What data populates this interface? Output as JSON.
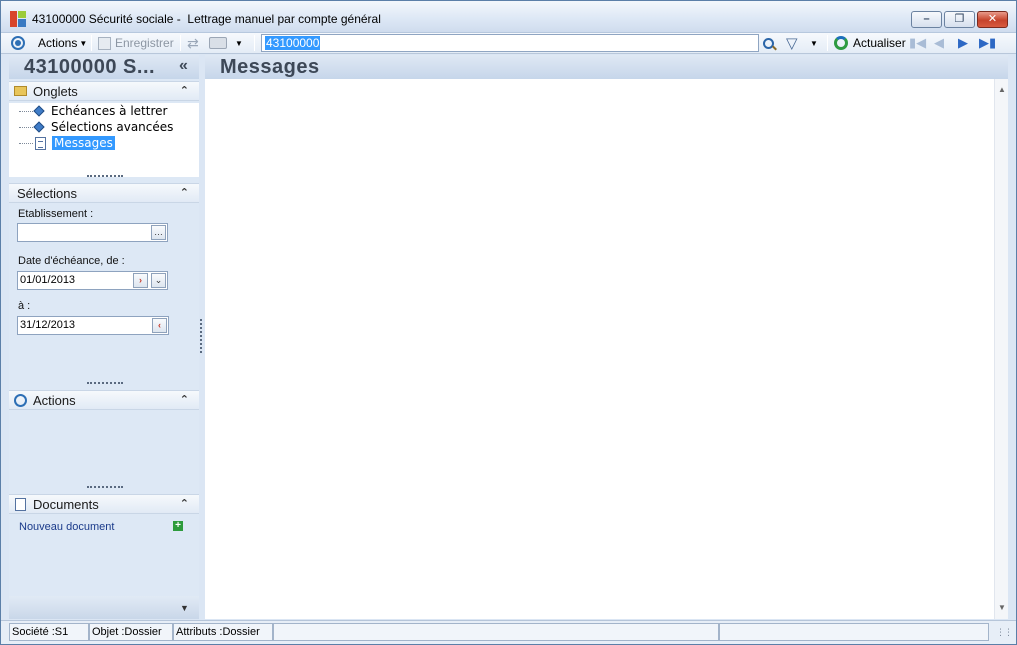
{
  "window": {
    "title": "43100000 Sécurité sociale -  Lettrage manuel par compte général"
  },
  "toolbar": {
    "actions_label": "Actions",
    "save_label": "Enregistrer",
    "search_value": "43100000",
    "refresh_label": "Actualiser"
  },
  "left_panel": {
    "title": "43100000 S...",
    "collapse_glyph": "«",
    "sections": {
      "onglets": {
        "label": "Onglets",
        "items": [
          {
            "label": "Echéances à lettrer",
            "icon": "diamond-icon"
          },
          {
            "label": "Sélections avancées",
            "icon": "diamond-icon"
          },
          {
            "label": "Messages",
            "icon": "document-icon",
            "selected": true
          }
        ]
      },
      "selections": {
        "label": "Sélections",
        "etablissement_label": "Etablissement :",
        "etablissement_value": "",
        "date_from_label": "Date d'échéance, de :",
        "date_from_value": "01/01/2013",
        "date_to_label": "à :",
        "date_to_value": "31/12/2013"
      },
      "actions": {
        "label": "Actions"
      },
      "documents": {
        "label": "Documents",
        "new_document_label": "Nouveau document"
      }
    }
  },
  "main": {
    "title": "Messages"
  },
  "statusbar": {
    "societe": "Société :S1",
    "objet": "Objet :Dossier",
    "attributs": "Attributs :Dossier"
  },
  "colors": {
    "selection_blue": "#3399ff",
    "panel_bg": "#dde8f5",
    "header_text": "#3d4857",
    "link_blue": "#1a3a8a"
  }
}
